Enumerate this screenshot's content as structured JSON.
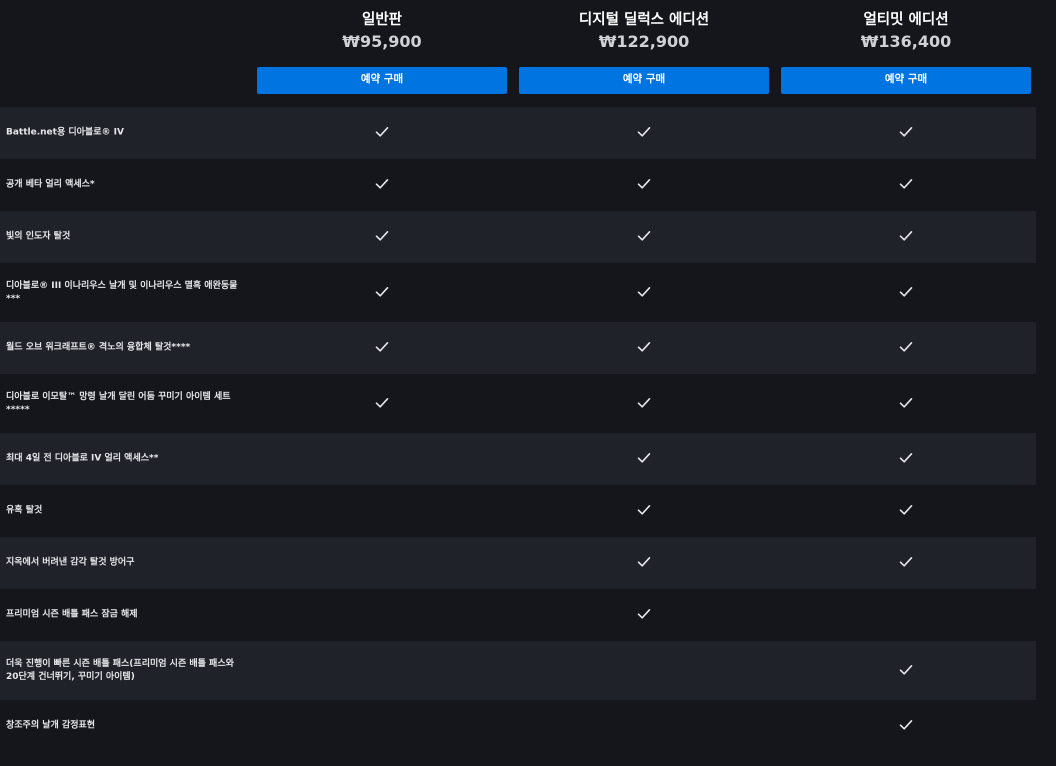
{
  "editions": [
    {
      "name": "일반판",
      "price": "₩95,900",
      "button_label": "예약 구매"
    },
    {
      "name": "디지털 딜럭스 에디션",
      "price": "₩122,900",
      "button_label": "예약 구매"
    },
    {
      "name": "얼티밋 에디션",
      "price": "₩136,400",
      "button_label": "예약 구매"
    }
  ],
  "features": [
    {
      "label": "Battle.net용 디아블로® IV",
      "included": [
        true,
        true,
        true
      ]
    },
    {
      "label": "공개 베타 얼리 액세스*",
      "included": [
        true,
        true,
        true
      ]
    },
    {
      "label": "빛의 인도자 탈것",
      "included": [
        true,
        true,
        true
      ]
    },
    {
      "label": "디아블로® III 이나리우스 날개 및 이나리우스 멸흑 애완동물***",
      "included": [
        true,
        true,
        true
      ]
    },
    {
      "label": "월드 오브 워크래프트® 격노의 융합체 탈것****",
      "included": [
        true,
        true,
        true
      ]
    },
    {
      "label": "디아블로 이모탈™ 망령 날개 달린 어둠 꾸미기 아이템 세트*****",
      "included": [
        true,
        true,
        true
      ]
    },
    {
      "label": "최대 4일 전 디아블로 IV 얼리 액세스**",
      "included": [
        false,
        true,
        true
      ]
    },
    {
      "label": "유혹 탈것",
      "included": [
        false,
        true,
        true
      ]
    },
    {
      "label": "지옥에서 버려낸 감각 탈것 방어구",
      "included": [
        false,
        true,
        true
      ]
    },
    {
      "label": "프리미엄 시즌 배틀 패스 잠금 해제",
      "included": [
        false,
        true,
        false
      ]
    },
    {
      "label": "더욱 진행이 빠른 시즌 배틀 패스(프리미엄 시즌 배틀 패스와 20단계 건너뛰기, 꾸미기 아이템)",
      "included": [
        false,
        false,
        true
      ]
    },
    {
      "label": "창조주의 날개 감정표현",
      "included": [
        false,
        false,
        true
      ]
    }
  ]
}
